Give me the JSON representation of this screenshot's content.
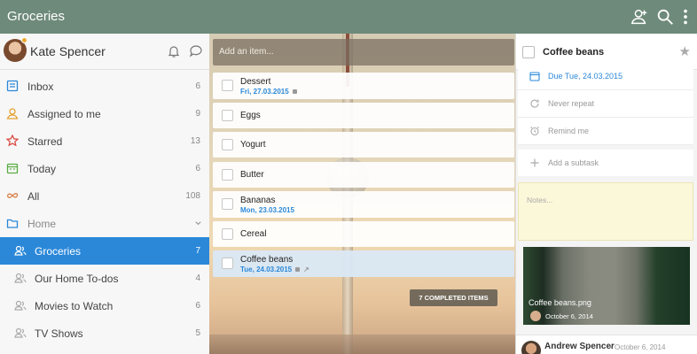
{
  "app": {
    "title": "Groceries",
    "icons": [
      "add-person-icon",
      "search-icon",
      "more-vert-icon"
    ]
  },
  "user": {
    "name": "Kate Spencer"
  },
  "sidebar": {
    "items": [
      {
        "label": "Inbox",
        "count": "6",
        "icon": "inbox-icon",
        "color": "#2b88d9"
      },
      {
        "label": "Assigned to me",
        "count": "9",
        "icon": "person-icon",
        "color": "#e5a233"
      },
      {
        "label": "Starred",
        "count": "13",
        "icon": "star-icon",
        "color": "#d9433b"
      },
      {
        "label": "Today",
        "count": "6",
        "icon": "calendar-icon",
        "color": "#5aac44"
      },
      {
        "label": "All",
        "count": "108",
        "icon": "infinity-icon",
        "color": "#d9824b"
      },
      {
        "label": "Home",
        "count": "",
        "icon": "folder-icon",
        "color": "#2b88d9"
      },
      {
        "label": "Groceries",
        "count": "7",
        "icon": "people-icon"
      },
      {
        "label": "Our Home To-dos",
        "count": "4",
        "icon": "people-icon"
      },
      {
        "label": "Movies to Watch",
        "count": "6",
        "icon": "people-icon"
      },
      {
        "label": "TV Shows",
        "count": "5",
        "icon": "people-icon"
      }
    ]
  },
  "add_item": {
    "placeholder": "Add an item..."
  },
  "tasks": [
    {
      "title": "Dessert",
      "due": "Fri, 27.03.2015"
    },
    {
      "title": "Eggs",
      "due": ""
    },
    {
      "title": "Yogurt",
      "due": ""
    },
    {
      "title": "Butter",
      "due": ""
    },
    {
      "title": "Bananas",
      "due": "Mon, 23.03.2015"
    },
    {
      "title": "Cereal",
      "due": ""
    },
    {
      "title": "Coffee beans",
      "due": "Tue, 24.03.2015"
    }
  ],
  "completed_label": "7 COMPLETED ITEMS",
  "detail": {
    "title": "Coffee beans",
    "due": "Due Tue, 24.03.2015",
    "repeat": "Never repeat",
    "remind": "Remind me",
    "subtask": "Add a subtask",
    "notes_placeholder": "Notes...",
    "attachment": {
      "name": "Coffee beans.png",
      "date": "October 6, 2014"
    },
    "comment": {
      "author": "Andrew Spencer",
      "date": "• October 6, 2014"
    }
  }
}
